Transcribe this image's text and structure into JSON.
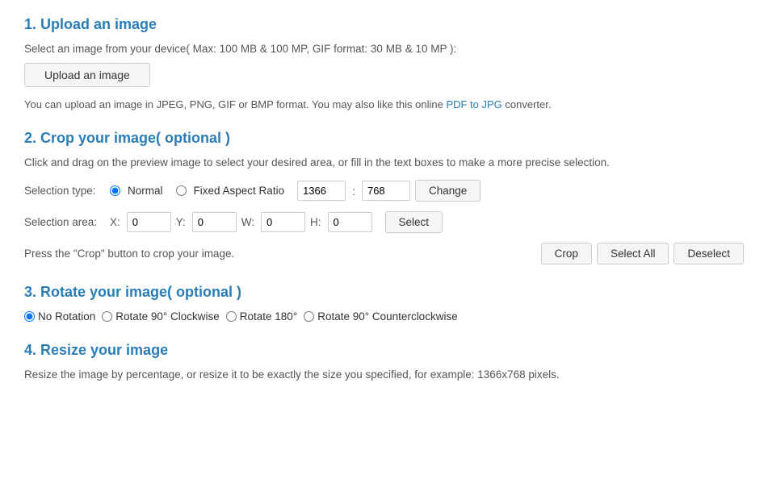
{
  "sections": {
    "upload": {
      "heading": "1. Upload an image",
      "description": "Select an image from your device( Max: 100 MB & 100 MP, GIF format: 30 MB & 10 MP ):",
      "button_label": "Upload an image",
      "info": "You can upload an image in JPEG, PNG, GIF or BMP format. You may also like this online ",
      "link_text": "PDF to JPG",
      "info_suffix": " converter."
    },
    "crop": {
      "heading": "2. Crop your image( optional )",
      "description": "Click and drag on the preview image to select your desired area, or fill in the text boxes to make a more precise selection.",
      "selection_type_label": "Selection type:",
      "radio_normal": "Normal",
      "radio_fixed": "Fixed Aspect Ratio",
      "width_val": "1366",
      "height_val": "768",
      "change_btn": "Change",
      "selection_area_label": "Selection area:",
      "x_label": "X:",
      "x_val": "0",
      "y_label": "Y:",
      "y_val": "0",
      "w_label": "W:",
      "w_val": "0",
      "h_label": "H:",
      "h_val": "0",
      "select_btn": "Select",
      "crop_prompt": "Press the \"Crop\" button to crop your image.",
      "crop_btn": "Crop",
      "select_all_btn": "Select All",
      "deselect_btn": "Deselect"
    },
    "rotate": {
      "heading": "3. Rotate your image( optional )",
      "no_rotation": "No Rotation",
      "cw90": "Rotate 90° Clockwise",
      "r180": "Rotate 180°",
      "ccw90": "Rotate 90° Counterclockwise"
    },
    "resize": {
      "heading": "4. Resize your image",
      "description": "Resize the image by percentage, or resize it to be exactly the size you specified, for example: 1366x768 pixels."
    }
  }
}
